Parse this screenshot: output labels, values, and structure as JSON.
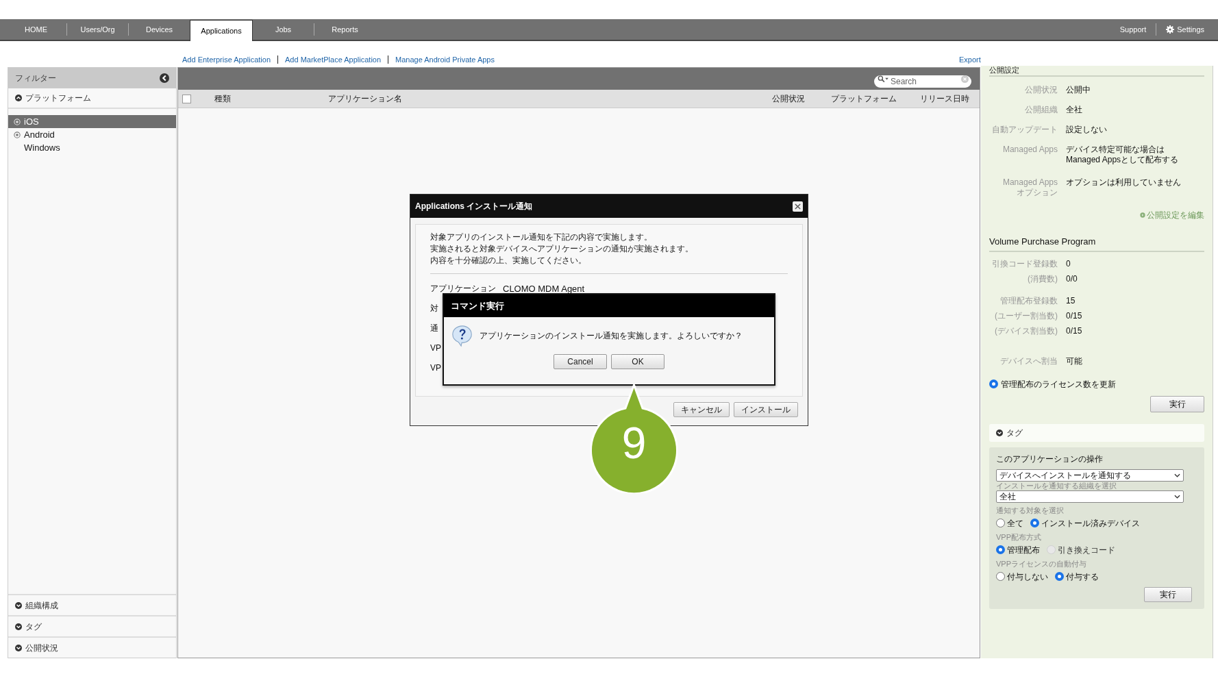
{
  "nav": {
    "tabs": [
      {
        "label": "HOME",
        "selected": false
      },
      {
        "label": "Users/Org",
        "selected": false
      },
      {
        "label": "Devices",
        "selected": false
      },
      {
        "label": "Applications",
        "selected": true
      },
      {
        "label": "Jobs",
        "selected": false
      },
      {
        "label": "Reports",
        "selected": false
      }
    ],
    "right": [
      {
        "label": "Support",
        "kind": "plain"
      },
      {
        "label": "Settings",
        "kind": "gear"
      }
    ]
  },
  "links": [
    "Add Enterprise Application",
    "Add MarketPlace Application",
    "Manage Android Private Apps"
  ],
  "export": "Export",
  "sidebar": {
    "title": "フィルター",
    "section": "プラットフォーム",
    "platforms": [
      {
        "label": "iOS",
        "selected": true,
        "kind": "icon"
      },
      {
        "label": "Android",
        "selected": false,
        "kind": "icon"
      },
      {
        "label": "Windows",
        "selected": false,
        "kind": "plain"
      }
    ],
    "footer_sections": [
      "組織構成",
      "タグ",
      "公開状況"
    ]
  },
  "table": {
    "select_all_checked": false,
    "search_placeholder": "Search",
    "columns": [
      "種類",
      "アプリケーション名",
      "公開状況",
      "プラットフォーム",
      "リリース日時"
    ]
  },
  "publish": {
    "heading": "公開設定",
    "rows": [
      {
        "label": "公開状況",
        "value": "公開中"
      },
      {
        "label": "公開組織",
        "value": "全社"
      },
      {
        "label": "自動アップデート",
        "value": "設定しない"
      },
      {
        "label": "Managed Apps",
        "value": "デバイス特定可能な場合は\nManaged Appsとして配布する"
      },
      {
        "label": "Managed Apps\nオプション",
        "value": "オプションは利用していません"
      }
    ],
    "edit_link": "公開設定を編集"
  },
  "vpp": {
    "heading": "Volume Purchase Program",
    "groups": [
      [
        {
          "label": "引換コード登録数",
          "value": "0"
        },
        {
          "label": "(消費数)",
          "value": "0/0"
        }
      ],
      [
        {
          "label": "管理配布登録数",
          "value": "15"
        },
        {
          "label": "(ユーザー割当数)",
          "value": "0/15"
        },
        {
          "label": "(デバイス割当数)",
          "value": "0/15"
        }
      ],
      [
        {
          "label": "デバイスへ割当",
          "value": "可能"
        }
      ]
    ],
    "radio": {
      "label": "管理配布のライセンス数を更新",
      "checked": true
    },
    "button": "実行"
  },
  "tag_section": "タグ",
  "operations": {
    "title": "このアプリケーションの操作",
    "action": "デバイスへインストールを通知する",
    "org_label": "インストールを通知する組織を選択",
    "org": "全社",
    "radio_groups": [
      {
        "label": "通知する対象を選択",
        "options": [
          {
            "label": "全て",
            "checked": false,
            "disabled": false
          },
          {
            "label": "インストール済みデバイス",
            "checked": true,
            "disabled": false
          }
        ]
      },
      {
        "label": "VPP配布方式",
        "options": [
          {
            "label": "管理配布",
            "checked": true,
            "disabled": false
          },
          {
            "label": "引き換えコード",
            "checked": false,
            "disabled": true
          }
        ]
      },
      {
        "label": "VPPライセンスの自動付与",
        "options": [
          {
            "label": "付与しない",
            "checked": false,
            "disabled": false
          },
          {
            "label": "付与する",
            "checked": true,
            "disabled": false
          }
        ]
      }
    ],
    "button": "実行"
  },
  "dialog": {
    "title": "Applications インストール通知",
    "message": [
      "対象アプリのインストール通知を下記の内容で実施します。",
      "実施されると対象デバイスへアプリケーションの通知が実施されます。",
      "内容を十分確認の上、実施してください。"
    ],
    "app_label": "アプリケーション",
    "app_value": "CLOMO MDM Agent",
    "covered_labels": [
      "対",
      "通",
      "VP",
      "VP"
    ],
    "buttons": [
      "キャンセル",
      "インストール"
    ]
  },
  "confirm": {
    "title": "コマンド実行",
    "message": "アプリケーションのインストール通知を実施します。よろしいですか？",
    "buttons": [
      "Cancel",
      "OK"
    ]
  },
  "callout": "9"
}
